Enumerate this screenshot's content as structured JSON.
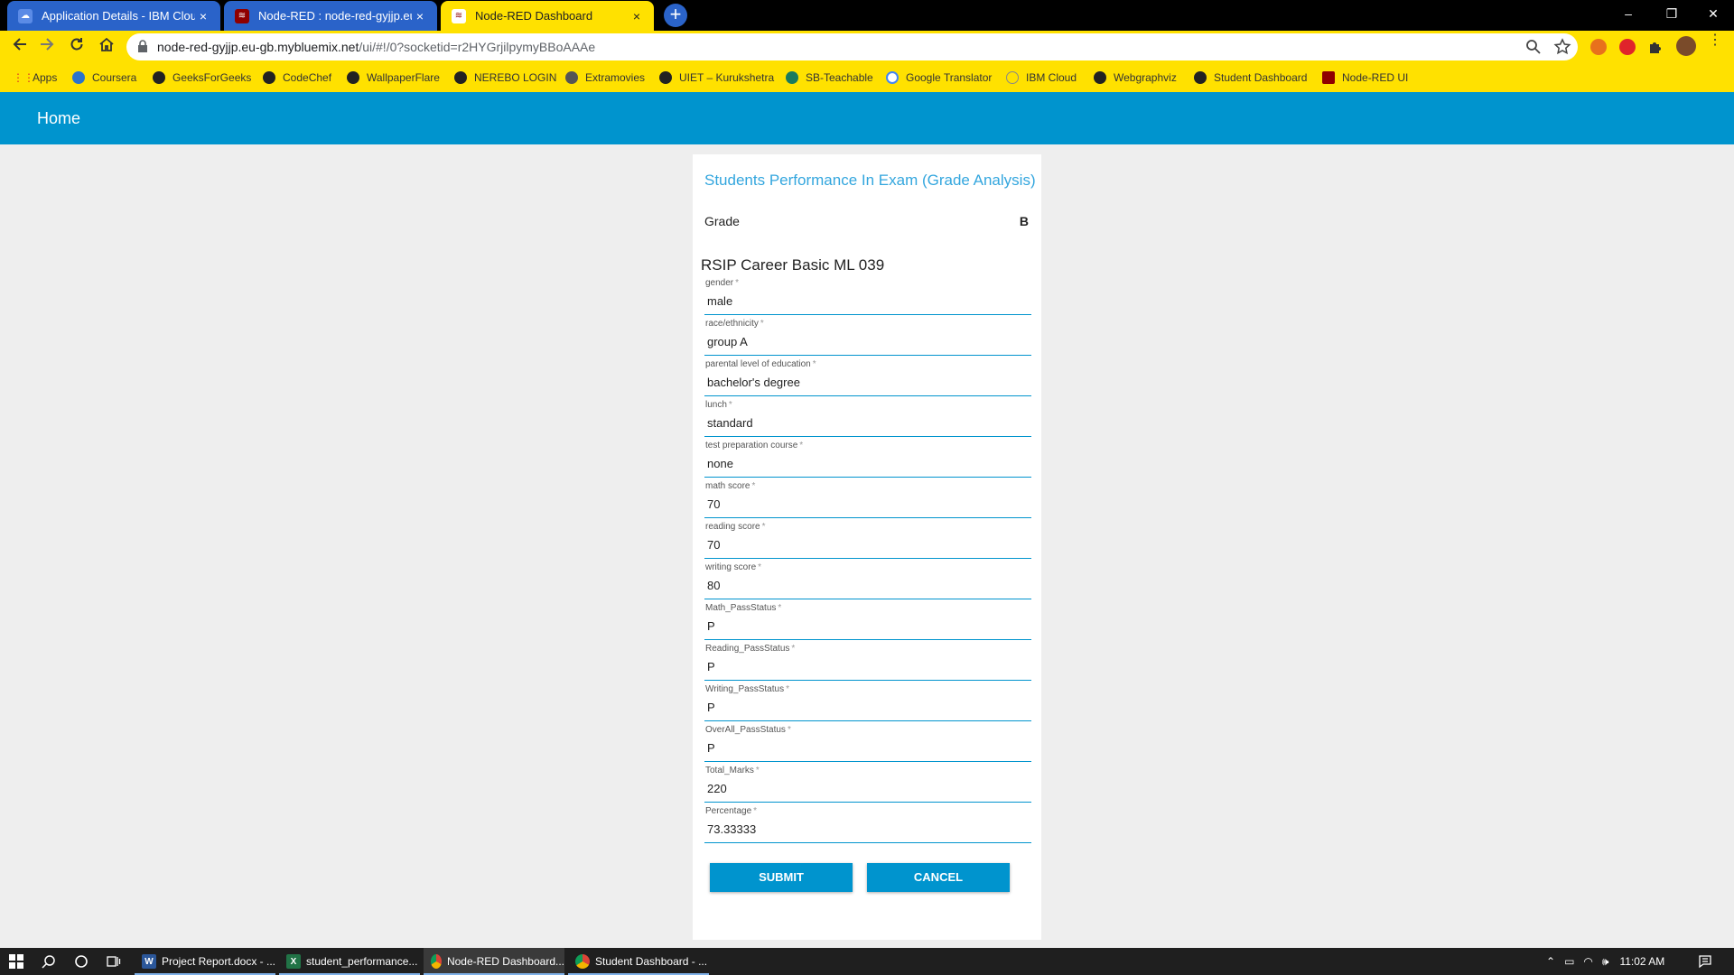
{
  "browser": {
    "tabs": [
      {
        "title": "Application Details - IBM Cloud",
        "active": false
      },
      {
        "title": "Node-RED : node-red-gyjjp.eu-gb",
        "active": false
      },
      {
        "title": "Node-RED Dashboard",
        "active": true
      }
    ],
    "close_glyph": "×",
    "new_tab_glyph": "+",
    "window_controls": {
      "minimize": "–",
      "restore": "❐",
      "close": "✕"
    },
    "url_host": "node-red-gyjjp.eu-gb.mybluemix.net",
    "url_path": "/ui/#!/0?socketid=r2HYGrjilpymyBBoAAAe",
    "bookmarks": [
      "Apps",
      "Coursera",
      "GeeksForGeeks",
      "CodeChef",
      "WallpaperFlare",
      "NEREBO LOGIN",
      "Extramovies",
      "UIET – Kurukshetra",
      "SB-Teachable",
      "Google Translator",
      "IBM Cloud",
      "Webgraphviz",
      "Student Dashboard",
      "Node-RED UI"
    ],
    "accent_color": "#ffe100"
  },
  "dashboard": {
    "header_title": "Home",
    "header_color": "#0094ce",
    "card_title": "Students Performance In Exam (Grade Analysis)",
    "grade_label": "Grade",
    "grade_value": "B",
    "form_title": "RSIP Career Basic ML 039",
    "required_mark": "*",
    "fields": [
      {
        "label": "gender",
        "value": "male"
      },
      {
        "label": "race/ethnicity",
        "value": "group A"
      },
      {
        "label": "parental level of education",
        "value": "bachelor's degree"
      },
      {
        "label": "lunch",
        "value": "standard"
      },
      {
        "label": "test preparation course",
        "value": "none"
      },
      {
        "label": "math score",
        "value": "70"
      },
      {
        "label": "reading score",
        "value": "70"
      },
      {
        "label": "writing score",
        "value": "80"
      },
      {
        "label": "Math_PassStatus",
        "value": "P"
      },
      {
        "label": "Reading_PassStatus",
        "value": "P"
      },
      {
        "label": "Writing_PassStatus",
        "value": "P"
      },
      {
        "label": "OverAll_PassStatus",
        "value": "P"
      },
      {
        "label": "Total_Marks",
        "value": "220"
      },
      {
        "label": "Percentage",
        "value": "73.33333"
      }
    ],
    "submit_label": "SUBMIT",
    "cancel_label": "CANCEL"
  },
  "taskbar": {
    "apps": [
      {
        "label": "Project Report.docx - ...",
        "icon": "W"
      },
      {
        "label": "student_performance...",
        "icon": "X"
      },
      {
        "label": "Node-RED Dashboard...",
        "icon": "chrome"
      },
      {
        "label": "Student Dashboard - ...",
        "icon": "chrome"
      }
    ],
    "clock": "11:02 AM"
  }
}
